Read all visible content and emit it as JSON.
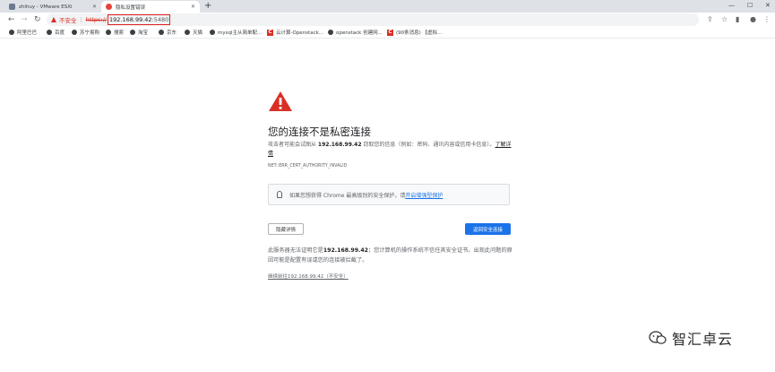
{
  "tabs": [
    {
      "title": "zhihuy - VMware ESXi",
      "active": false
    },
    {
      "title": "隐私设置错误",
      "active": true
    }
  ],
  "toolbar": {
    "not_secure": "不安全",
    "separator": "|",
    "scheme": "https://",
    "host": "192.168.99.42",
    "port": ":5480"
  },
  "bookmarks": [
    {
      "label": "阿里巴巴",
      "icon": "globe-icon"
    },
    {
      "label": "百度",
      "icon": "globe-icon"
    },
    {
      "label": "苏宁易购",
      "icon": "globe-icon"
    },
    {
      "label": "搜索",
      "icon": "globe-icon"
    },
    {
      "label": "淘宝",
      "icon": "globe-icon"
    },
    {
      "label": "京东",
      "icon": "globe-icon"
    },
    {
      "label": "天猫",
      "icon": "globe-icon"
    },
    {
      "label": "mysql主从简单配...",
      "icon": "globe-icon"
    },
    {
      "label": "云计算-Openstack...",
      "icon": "csdn-icon"
    },
    {
      "label": "openstack 创建网...",
      "icon": "globe-icon"
    },
    {
      "label": "(90条消息) 【虚拟...",
      "icon": "csdn-icon"
    }
  ],
  "page": {
    "heading": "您的连接不是私密连接",
    "body_prefix": "攻击者可能会试图从 ",
    "body_host": "192.168.99.42",
    "body_suffix": " 窃取您的信息（例如：密码、通讯内容或信用卡信息）。",
    "learn_more": "了解详情",
    "error_code": "NET::ERR_CERT_AUTHORITY_INVALID",
    "enhanced_prefix": "如果您想获得 Chrome 最高级别的安全保护，请",
    "enhanced_link": "开启增强型保护",
    "details_button": "隐藏详情",
    "back_button": "返回安全连接",
    "details_prefix": "此服务器无法证明它是",
    "details_host": "192.168.99.42",
    "details_suffix": "；您计算机的操作系统不信任其安全证书。出现此问题的原因可能是配置有误或您的连接被拦截了。",
    "proceed_link": "继续前往192.168.99.42（不安全）"
  },
  "watermark": {
    "text": "智汇卓云"
  },
  "colors": {
    "warning_red": "#d93025",
    "link_blue": "#1a73e8",
    "highlight_box": "#e02020"
  }
}
